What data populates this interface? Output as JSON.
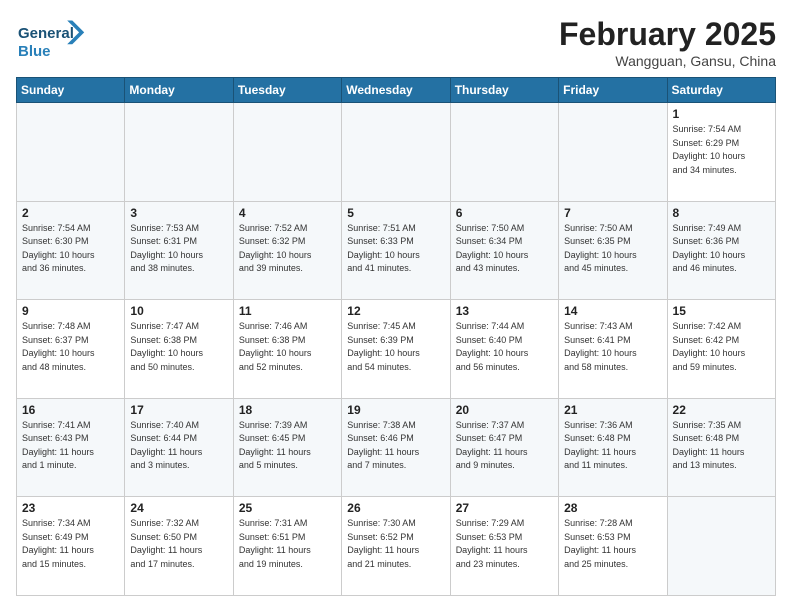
{
  "logo": {
    "line1": "General",
    "line2": "Blue"
  },
  "title": "February 2025",
  "subtitle": "Wangguan, Gansu, China",
  "weekdays": [
    "Sunday",
    "Monday",
    "Tuesday",
    "Wednesday",
    "Thursday",
    "Friday",
    "Saturday"
  ],
  "weeks": [
    [
      {
        "day": "",
        "info": ""
      },
      {
        "day": "",
        "info": ""
      },
      {
        "day": "",
        "info": ""
      },
      {
        "day": "",
        "info": ""
      },
      {
        "day": "",
        "info": ""
      },
      {
        "day": "",
        "info": ""
      },
      {
        "day": "1",
        "info": "Sunrise: 7:54 AM\nSunset: 6:29 PM\nDaylight: 10 hours\nand 34 minutes."
      }
    ],
    [
      {
        "day": "2",
        "info": "Sunrise: 7:54 AM\nSunset: 6:30 PM\nDaylight: 10 hours\nand 36 minutes."
      },
      {
        "day": "3",
        "info": "Sunrise: 7:53 AM\nSunset: 6:31 PM\nDaylight: 10 hours\nand 38 minutes."
      },
      {
        "day": "4",
        "info": "Sunrise: 7:52 AM\nSunset: 6:32 PM\nDaylight: 10 hours\nand 39 minutes."
      },
      {
        "day": "5",
        "info": "Sunrise: 7:51 AM\nSunset: 6:33 PM\nDaylight: 10 hours\nand 41 minutes."
      },
      {
        "day": "6",
        "info": "Sunrise: 7:50 AM\nSunset: 6:34 PM\nDaylight: 10 hours\nand 43 minutes."
      },
      {
        "day": "7",
        "info": "Sunrise: 7:50 AM\nSunset: 6:35 PM\nDaylight: 10 hours\nand 45 minutes."
      },
      {
        "day": "8",
        "info": "Sunrise: 7:49 AM\nSunset: 6:36 PM\nDaylight: 10 hours\nand 46 minutes."
      }
    ],
    [
      {
        "day": "9",
        "info": "Sunrise: 7:48 AM\nSunset: 6:37 PM\nDaylight: 10 hours\nand 48 minutes."
      },
      {
        "day": "10",
        "info": "Sunrise: 7:47 AM\nSunset: 6:38 PM\nDaylight: 10 hours\nand 50 minutes."
      },
      {
        "day": "11",
        "info": "Sunrise: 7:46 AM\nSunset: 6:38 PM\nDaylight: 10 hours\nand 52 minutes."
      },
      {
        "day": "12",
        "info": "Sunrise: 7:45 AM\nSunset: 6:39 PM\nDaylight: 10 hours\nand 54 minutes."
      },
      {
        "day": "13",
        "info": "Sunrise: 7:44 AM\nSunset: 6:40 PM\nDaylight: 10 hours\nand 56 minutes."
      },
      {
        "day": "14",
        "info": "Sunrise: 7:43 AM\nSunset: 6:41 PM\nDaylight: 10 hours\nand 58 minutes."
      },
      {
        "day": "15",
        "info": "Sunrise: 7:42 AM\nSunset: 6:42 PM\nDaylight: 10 hours\nand 59 minutes."
      }
    ],
    [
      {
        "day": "16",
        "info": "Sunrise: 7:41 AM\nSunset: 6:43 PM\nDaylight: 11 hours\nand 1 minute."
      },
      {
        "day": "17",
        "info": "Sunrise: 7:40 AM\nSunset: 6:44 PM\nDaylight: 11 hours\nand 3 minutes."
      },
      {
        "day": "18",
        "info": "Sunrise: 7:39 AM\nSunset: 6:45 PM\nDaylight: 11 hours\nand 5 minutes."
      },
      {
        "day": "19",
        "info": "Sunrise: 7:38 AM\nSunset: 6:46 PM\nDaylight: 11 hours\nand 7 minutes."
      },
      {
        "day": "20",
        "info": "Sunrise: 7:37 AM\nSunset: 6:47 PM\nDaylight: 11 hours\nand 9 minutes."
      },
      {
        "day": "21",
        "info": "Sunrise: 7:36 AM\nSunset: 6:48 PM\nDaylight: 11 hours\nand 11 minutes."
      },
      {
        "day": "22",
        "info": "Sunrise: 7:35 AM\nSunset: 6:48 PM\nDaylight: 11 hours\nand 13 minutes."
      }
    ],
    [
      {
        "day": "23",
        "info": "Sunrise: 7:34 AM\nSunset: 6:49 PM\nDaylight: 11 hours\nand 15 minutes."
      },
      {
        "day": "24",
        "info": "Sunrise: 7:32 AM\nSunset: 6:50 PM\nDaylight: 11 hours\nand 17 minutes."
      },
      {
        "day": "25",
        "info": "Sunrise: 7:31 AM\nSunset: 6:51 PM\nDaylight: 11 hours\nand 19 minutes."
      },
      {
        "day": "26",
        "info": "Sunrise: 7:30 AM\nSunset: 6:52 PM\nDaylight: 11 hours\nand 21 minutes."
      },
      {
        "day": "27",
        "info": "Sunrise: 7:29 AM\nSunset: 6:53 PM\nDaylight: 11 hours\nand 23 minutes."
      },
      {
        "day": "28",
        "info": "Sunrise: 7:28 AM\nSunset: 6:53 PM\nDaylight: 11 hours\nand 25 minutes."
      },
      {
        "day": "",
        "info": ""
      }
    ]
  ]
}
